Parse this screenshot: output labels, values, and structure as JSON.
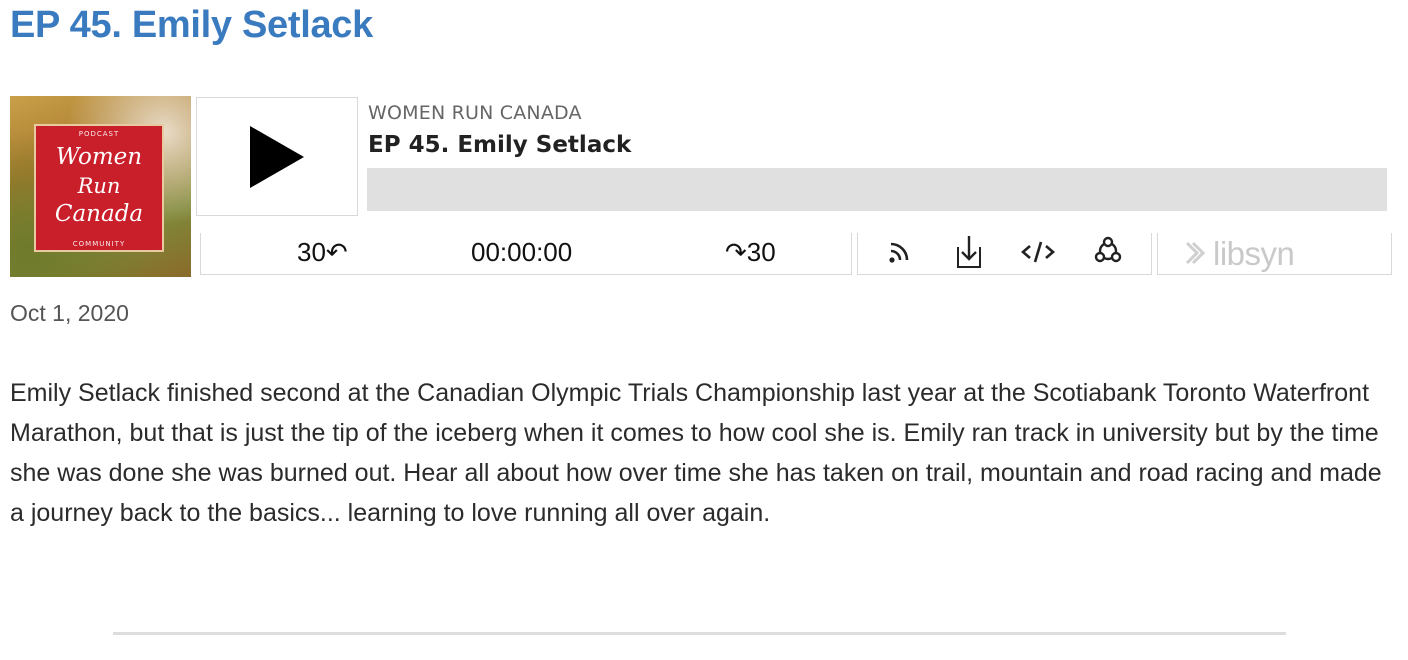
{
  "page": {
    "title": "EP 45. Emily Setlack"
  },
  "player": {
    "cover": {
      "top_text": "PODCAST",
      "line1": "Women",
      "line2": "Run",
      "line3": "Canada",
      "bottom_text": "COMMUNITY"
    },
    "podcast_name": "WOMEN RUN CANADA",
    "episode_title": "EP 45. Emily Setlack",
    "progress_fraction": 0,
    "rewind_label": "30↶",
    "timestamp": "00:00:00",
    "forward_label": "↷30",
    "tools": [
      "rss-icon",
      "download-icon",
      "embed-icon",
      "share-icon"
    ],
    "brand": "libsyn"
  },
  "post": {
    "date": "Oct 1, 2020",
    "description": "Emily Setlack finished second at the Canadian Olympic Trials Championship last year at the Scotiabank Toronto Waterfront Marathon, but that is just the tip of the iceberg when it comes to how cool she is. Emily ran track in university but by the time she was done she was burned out. Hear all about how over time she has taken on trail, mountain and road racing and made a journey back to the basics... learning to love running all over again."
  },
  "colors": {
    "title": "#3a7abf",
    "progress_track": "#e0e0e0",
    "cover_red": "#c91f2b"
  }
}
